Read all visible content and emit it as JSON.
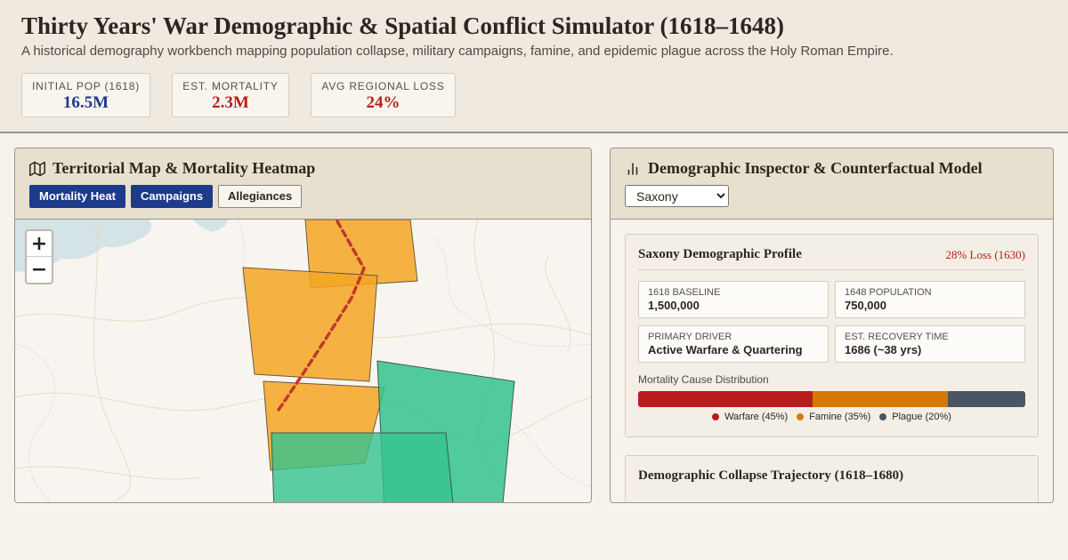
{
  "header": {
    "title": "Thirty Years' War Demographic & Spatial Conflict Simulator (1618–1648)",
    "subtitle": "A historical demography workbench mapping population collapse, military campaigns, famine, and epidemic plague across the Holy Roman Empire.",
    "stats": [
      {
        "label": "INITIAL POP (1618)",
        "value": "16.5M",
        "color": "#1e3a8a"
      },
      {
        "label": "EST. MORTALITY",
        "value": "2.3M",
        "color": "#b91c1c"
      },
      {
        "label": "AVG REGIONAL LOSS",
        "value": "24%",
        "color": "#b91c1c"
      }
    ]
  },
  "map_panel": {
    "title": "Territorial Map & Mortality Heatmap",
    "icon": "map-icon",
    "layers": [
      {
        "label": "Mortality Heat",
        "active": true
      },
      {
        "label": "Campaigns",
        "active": true
      },
      {
        "label": "Allegiances",
        "active": false
      }
    ],
    "zoom_in": "+",
    "zoom_out": "−",
    "colors": {
      "mortality": "#f5a623",
      "plague": "#34c38f",
      "campaign": "#c0392b"
    }
  },
  "inspector": {
    "title": "Demographic Inspector & Counterfactual Model",
    "icon": "bar-chart-icon",
    "region_selected": "Saxony",
    "profile": {
      "title": "Saxony Demographic Profile",
      "loss_badge": "28% Loss (1630)",
      "metrics": [
        {
          "label": "1618 Baseline",
          "value": "1,500,000"
        },
        {
          "label": "1648 Population",
          "value": "750,000"
        },
        {
          "label": "Primary Driver",
          "value": "Active Warfare & Quartering"
        },
        {
          "label": "Est. Recovery Time",
          "value": "1686 (~38 yrs)"
        }
      ],
      "distribution_title": "Mortality Cause Distribution",
      "distribution": [
        {
          "label": "Warfare (45%)",
          "percent": 45,
          "color": "#b91c1c"
        },
        {
          "label": "Famine (35%)",
          "percent": 35,
          "color": "#d97706"
        },
        {
          "label": "Plague (20%)",
          "percent": 20,
          "color": "#4b5563"
        }
      ]
    },
    "trajectory": {
      "title": "Demographic Collapse Trajectory (1618–1680)"
    }
  }
}
